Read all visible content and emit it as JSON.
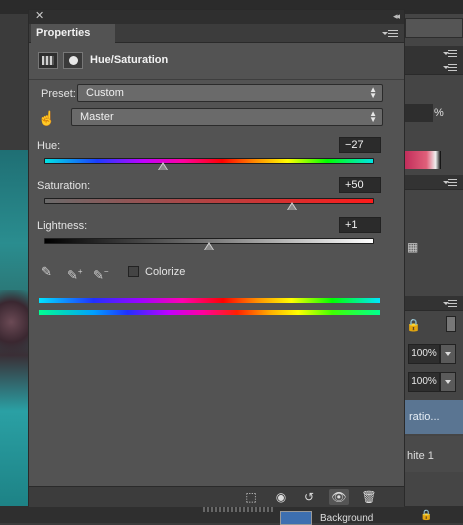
{
  "panel": {
    "tab": "Properties",
    "adjustment_title": "Hue/Saturation",
    "preset": {
      "label": "Preset:",
      "value": "Custom"
    },
    "channel": {
      "value": "Master"
    },
    "hue": {
      "label": "Hue:",
      "value": "−27",
      "fraction": 0.36
    },
    "saturation": {
      "label": "Saturation:",
      "value": "+50",
      "fraction": 0.75
    },
    "lightness": {
      "label": "Lightness:",
      "value": "+1",
      "fraction": 0.5
    },
    "colorize": {
      "label": "Colorize",
      "checked": false
    }
  },
  "background_ui": {
    "percent_symbol": "%",
    "opacity": "100%",
    "fill": "100%",
    "layer_name_partial": "ratio...",
    "layer2_partial": "hite 1",
    "background_label": "Background"
  },
  "colors": {
    "panel_bg": "#535353",
    "titlebar": "#2f2f2f",
    "selected_layer": "#5a7592"
  },
  "icons": [
    "close-icon",
    "collapse-icon",
    "panel-menu-icon",
    "adjustment-icon",
    "mask-icon",
    "targeted-adjustment-hand-icon",
    "eyedropper-icon",
    "eyedropper-plus-icon",
    "eyedropper-minus-icon",
    "clip-to-layer-icon",
    "view-previous-icon",
    "reset-icon",
    "visibility-eye-icon",
    "trash-icon"
  ]
}
